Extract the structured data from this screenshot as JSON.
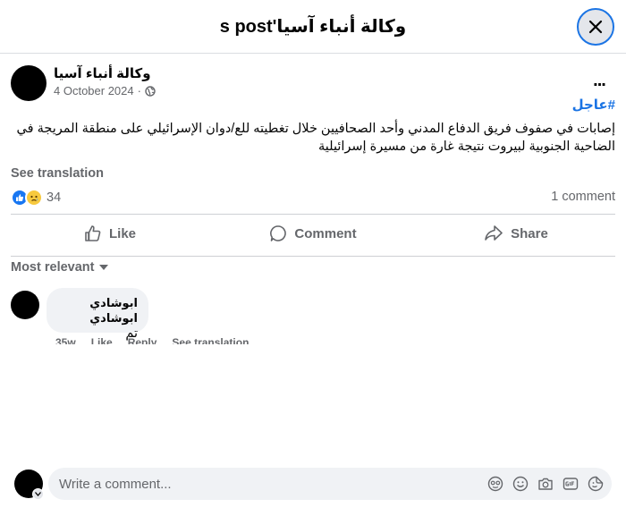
{
  "header": {
    "title": "s post'وكالة أنباء آسيا"
  },
  "post": {
    "author": "وكالة أنباء آسيا",
    "date": "4 October 2024",
    "meta_separator": "·",
    "hashtag": "#عاجل",
    "text": "إصابات في صفوف فريق الدفاع المدني وأحد الصحافيين خلال تغطيته للع/دوان الإسرائيلي على منطقة المريجة في الضاحية الجنوبية لبيروت نتيجة غارة من مسيرة إسرائيلية",
    "see_translation": "See translation",
    "reaction_count": "34",
    "comment_count": "1 comment",
    "more_label": "..."
  },
  "actions": {
    "like": "Like",
    "comment": "Comment",
    "share": "Share"
  },
  "comments_section": {
    "sort_label": "Most relevant",
    "items": [
      {
        "author": "ابوشادي ابوشادي",
        "text": "تم",
        "time": "35w",
        "like": "Like",
        "reply": "Reply",
        "translate": "See translation"
      }
    ]
  },
  "composer": {
    "placeholder": "Write a comment..."
  },
  "colors": {
    "accent": "#1b74e4",
    "secondary_text": "#65676b",
    "bubble": "#f0f2f5"
  }
}
